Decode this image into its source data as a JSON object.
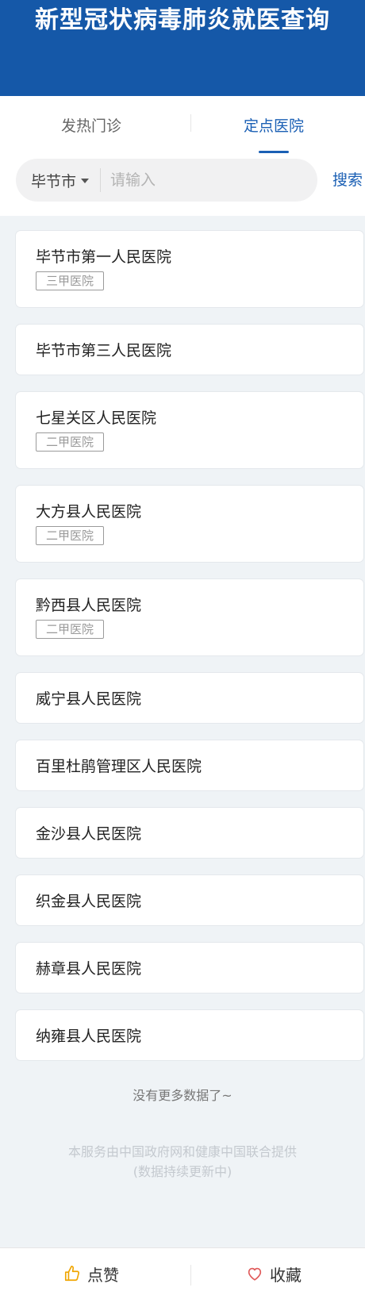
{
  "header": {
    "title": "新型冠状病毒肺炎就医查询"
  },
  "tabs": [
    {
      "label": "发热门诊",
      "active": false
    },
    {
      "label": "定点医院",
      "active": true
    }
  ],
  "search": {
    "city": "毕节市",
    "placeholder": "请输入",
    "value": "",
    "button_label": "搜索"
  },
  "hospitals": [
    {
      "name": "毕节市第一人民医院",
      "tag": "三甲医院"
    },
    {
      "name": "毕节市第三人民医院",
      "tag": ""
    },
    {
      "name": "七星关区人民医院",
      "tag": "二甲医院"
    },
    {
      "name": "大方县人民医院",
      "tag": "二甲医院"
    },
    {
      "name": "黔西县人民医院",
      "tag": "二甲医院"
    },
    {
      "name": "威宁县人民医院",
      "tag": ""
    },
    {
      "name": "百里杜鹃管理区人民医院",
      "tag": ""
    },
    {
      "name": "金沙县人民医院",
      "tag": ""
    },
    {
      "name": "织金县人民医院",
      "tag": ""
    },
    {
      "name": "赫章县人民医院",
      "tag": ""
    },
    {
      "name": "纳雍县人民医院",
      "tag": ""
    }
  ],
  "list_end_text": "没有更多数据了~",
  "footer_note": {
    "line1": "本服务由中国政府网和健康中国联合提供",
    "line2": "(数据持续更新中)"
  },
  "bottom_bar": {
    "like_label": "点赞",
    "like_icon": "thumbs-up-icon",
    "favorite_label": "收藏",
    "favorite_icon": "heart-icon"
  },
  "colors": {
    "header_bg": "#1558a8",
    "accent": "#1a5fb4",
    "like_icon": "#f0a500",
    "favorite_icon": "#e05a5a"
  }
}
